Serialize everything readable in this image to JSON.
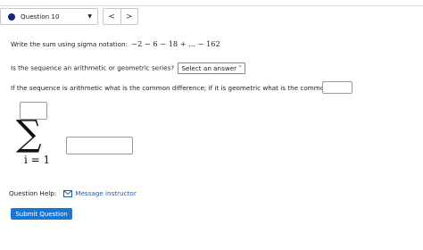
{
  "header": {
    "question_label": "Question 10",
    "caret_glyph": "▼",
    "prev_glyph": "<",
    "next_glyph": ">"
  },
  "question": {
    "prompt": "Write the sum using sigma notation:",
    "expression": "−2 − 6 − 18 + ... − 162",
    "type_prompt": "Is the sequence an arithmetic or geometric series?",
    "type_select": "Select an answer ˅",
    "diff_prompt": "If the sequence is arithmetic what is the common difference; if it is geometric what is the common ratio?",
    "sigma_symbol": "∑",
    "sigma_lower": "i = 1"
  },
  "help": {
    "label": "Question Help:",
    "link": "Message instructor"
  },
  "submit": {
    "label": "Submit Question"
  },
  "colors": {
    "accent": "#1976d2",
    "link": "#1a5fb4",
    "status_dot": "#1a237e"
  }
}
